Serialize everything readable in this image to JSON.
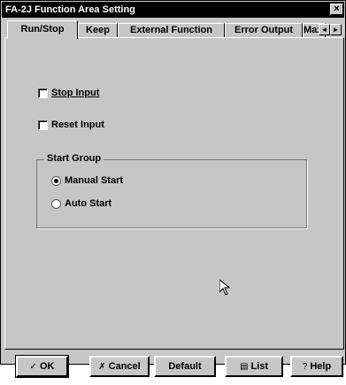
{
  "window": {
    "title": "FA-2J Function Area Setting",
    "close_label": "×"
  },
  "tabs": [
    {
      "label": "Run/Stop"
    },
    {
      "label": "Keep"
    },
    {
      "label": "External Function"
    },
    {
      "label": "Error Output"
    },
    {
      "label": "Max I..."
    }
  ],
  "tab_scroll": {
    "left": "◄",
    "right": "►"
  },
  "options": {
    "stop_input": {
      "label": "Stop Input",
      "checked": false
    },
    "reset_input": {
      "label": "Reset Input",
      "checked": false
    }
  },
  "start_group": {
    "label": "Start Group",
    "options": [
      {
        "label": "Manual Start",
        "selected": true
      },
      {
        "label": "Auto Start",
        "selected": false
      }
    ]
  },
  "buttons": {
    "ok": {
      "icon": "✓",
      "label": "OK"
    },
    "cancel": {
      "icon": "✗",
      "label": "Cancel"
    },
    "default": {
      "label": "Default"
    },
    "list": {
      "icon": "▤",
      "label": "List"
    },
    "help": {
      "icon": "?",
      "label": "Help"
    }
  }
}
